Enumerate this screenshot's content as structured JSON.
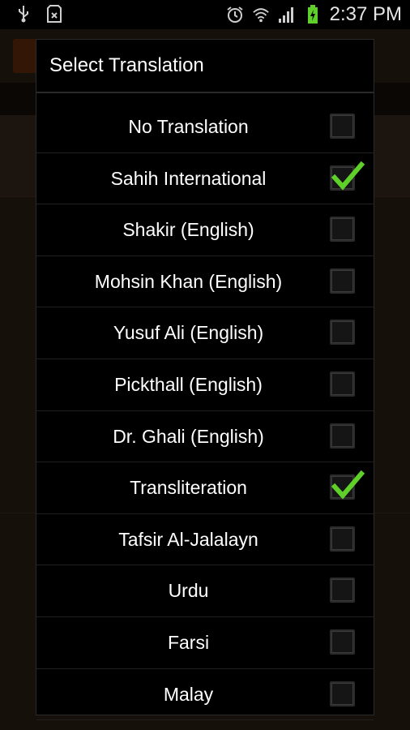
{
  "status_bar": {
    "time": "2:37 PM",
    "icons": [
      "usb-icon",
      "sd-card-icon",
      "alarm-icon",
      "wifi-icon",
      "signal-icon",
      "battery-charging-icon"
    ]
  },
  "dialog": {
    "title": "Select Translation",
    "items": [
      {
        "label": "No Translation",
        "checked": false
      },
      {
        "label": "Sahih International",
        "checked": true
      },
      {
        "label": "Shakir (English)",
        "checked": false
      },
      {
        "label": "Mohsin Khan (English)",
        "checked": false
      },
      {
        "label": "Yusuf Ali (English)",
        "checked": false
      },
      {
        "label": "Pickthall (English)",
        "checked": false
      },
      {
        "label": "Dr. Ghali (English)",
        "checked": false
      },
      {
        "label": "Transliteration",
        "checked": true
      },
      {
        "label": "Tafsir Al-Jalalayn",
        "checked": false
      },
      {
        "label": "Urdu",
        "checked": false
      },
      {
        "label": "Farsi",
        "checked": false
      },
      {
        "label": "Malay",
        "checked": false
      }
    ]
  },
  "colors": {
    "check": "#5fcf2a",
    "dialog_bg": "#000000",
    "app_bg": "#3b2a1b"
  }
}
